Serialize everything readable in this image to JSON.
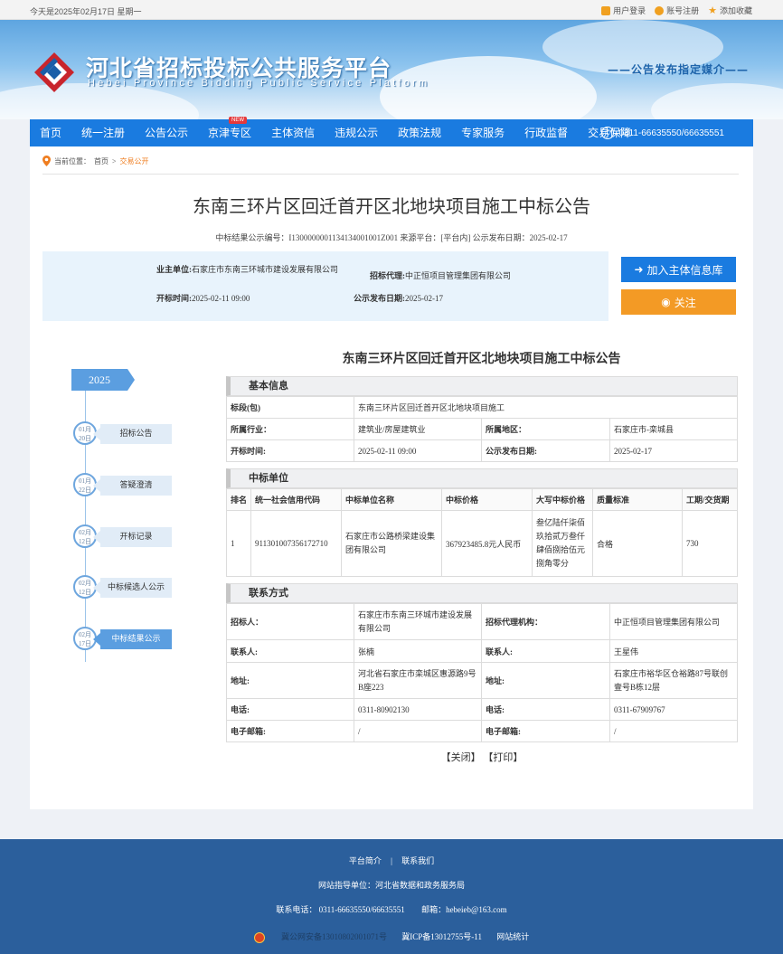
{
  "topbar": {
    "date": "今天是2025年02月17日 星期一",
    "login": "用户登录",
    "register": "账号注册",
    "favorite": "添加收藏"
  },
  "banner": {
    "title": "河北省招标投标公共服务平台",
    "subtitle_en": "Hebei Province Bidding Public Service Platform",
    "media": "——公告发布指定媒介——"
  },
  "nav": {
    "items": [
      "首页",
      "统一注册",
      "公告公示",
      "京津专区",
      "主体资信",
      "违规公示",
      "政策法规",
      "专家服务",
      "行政监督",
      "交易保障"
    ],
    "new_badge": "NEW",
    "phone": "0311-66635550/66635551"
  },
  "breadcrumb": {
    "prefix": "当前位置：",
    "home": "首页",
    "sep": ">",
    "current": "交易公开"
  },
  "notice": {
    "title": "东南三环片区回迁首开区北地块项目施工中标公告",
    "meta": "中标结果公示编号：I1300000001134134001001Z001   来源平台：[平台内]   公示发布日期：2025-02-17"
  },
  "infobox": {
    "owner_label": "业主单位:",
    "owner_value": "石家庄市东南三环城市建设发展有限公司",
    "agent_label": "招标代理:",
    "agent_value": "中正恒项目管理集团有限公司",
    "open_label": "开标时间:",
    "open_value": "2025-02-11 09:00",
    "pub_label": "公示发布日期:",
    "pub_value": "2025-02-17"
  },
  "buttons": {
    "add": "加入主体信息库",
    "follow": "关注"
  },
  "timeline": {
    "year": "2025",
    "items": [
      {
        "month": "01月",
        "day": "20日",
        "label": "招标公告"
      },
      {
        "month": "01月",
        "day": "22日",
        "label": "答疑澄清"
      },
      {
        "month": "02月",
        "day": "12日",
        "label": "开标记录"
      },
      {
        "month": "02月",
        "day": "12日",
        "label": "中标候选人公示"
      },
      {
        "month": "02月",
        "day": "17日",
        "label": "中标结果公示"
      }
    ]
  },
  "section_title": "东南三环片区回迁首开区北地块项目施工中标公告",
  "basic": {
    "head": "基本信息",
    "section_label": "标段(包)",
    "section_value": "东南三环片区回迁首开区北地块项目施工",
    "industry_label": "所属行业：",
    "industry_value": "建筑业/房屋建筑业",
    "region_label": "所属地区：",
    "region_value": "石家庄市-栾城县",
    "open_label": "开标时间:",
    "open_value": "2025-02-11 09:00",
    "pub_label": "公示发布日期:",
    "pub_value": "2025-02-17"
  },
  "winner": {
    "head": "中标单位",
    "columns": [
      "排名",
      "统一社会信用代码",
      "中标单位名称",
      "中标价格",
      "大写中标价格",
      "质量标准",
      "工期/交货期"
    ],
    "rank": "1",
    "code": "911301007356172710",
    "name": "石家庄市公路桥梁建设集团有限公司",
    "price": "367923485.8元人民币",
    "price_upper": "叁亿陆仟柒佰玖拾贰万叁仟肆佰捌拾伍元捌角零分",
    "quality": "合格",
    "period": "730"
  },
  "contact": {
    "head": "联系方式",
    "tenderer_label": "招标人：",
    "tenderer_value": "石家庄市东南三环城市建设发展有限公司",
    "agency_label": "招标代理机构：",
    "agency_value": "中正恒项目管理集团有限公司",
    "person_label": "联系人:",
    "person_value": "张楠",
    "person2_label": "联系人:",
    "person2_value": "王星伟",
    "addr_label": "地址:",
    "addr_value": "河北省石家庄市栾城区惠源路9号B座223",
    "addr2_label": "地址:",
    "addr2_value": "石家庄市裕华区仓裕路87号联创壹号B栋12层",
    "tel_label": "电话:",
    "tel_value": "0311-80902130",
    "tel2_label": "电话:",
    "tel2_value": "0311-67909767",
    "mail_label": "电子邮箱:",
    "mail_value": "/",
    "mail2_label": "电子邮箱:",
    "mail2_value": "/"
  },
  "actions": {
    "close": "【关闭】",
    "print": "【打印】"
  },
  "footer": {
    "intro": "平台简介",
    "sep": "|",
    "contact": "联系我们",
    "guide": "网站指导单位：河北省数据和政务服务局",
    "phone": "联系电话： 0311-66635550/66635551",
    "email": "邮箱：hebeieb@163.com",
    "police": "冀公网安备13010802001071号",
    "icp": "冀ICP备13012755号-11",
    "stats": "网站统计"
  },
  "colors": {
    "nav_blue": "#1a7be0",
    "accent_orange": "#f39a25",
    "footer_blue": "#2b5f9c"
  }
}
